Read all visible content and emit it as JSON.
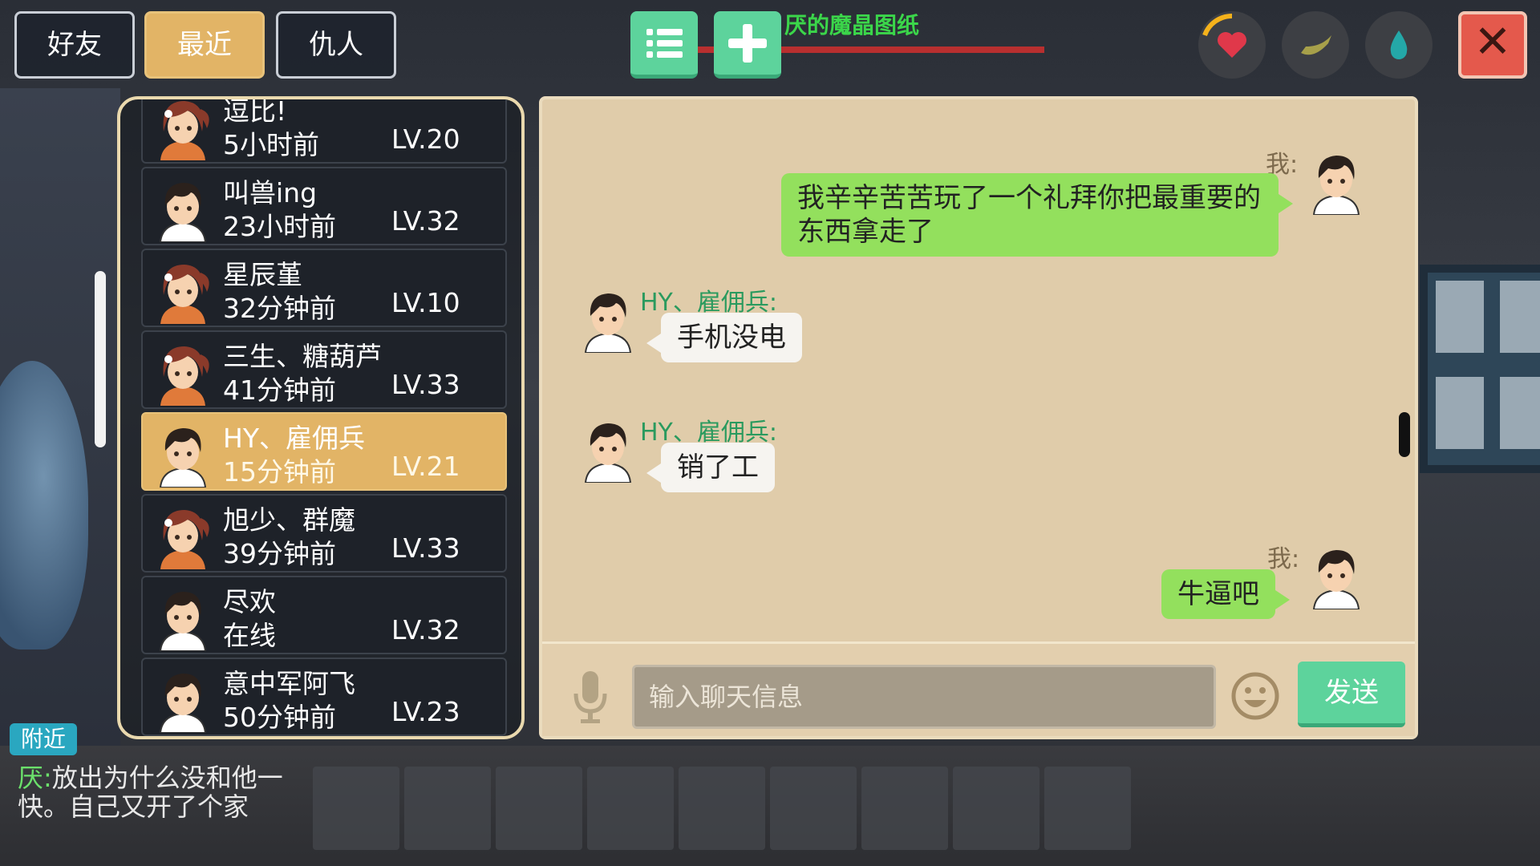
{
  "tabs": [
    {
      "label": "好友",
      "active": false
    },
    {
      "label": "最近",
      "active": true
    },
    {
      "label": "仇人",
      "active": false
    }
  ],
  "top_bar": {
    "quest_text": "厌的魔晶图纸",
    "list_icon": "list-icon",
    "add_icon": "plus-icon",
    "status_icons": [
      "heart-icon",
      "food-icon",
      "water-drop-icon"
    ],
    "close_icon": "close-icon",
    "close_symbol": "✕"
  },
  "friends": [
    {
      "name": "逗比!",
      "time": "5小时前",
      "level": "LV.20",
      "avatar": "female-avatar"
    },
    {
      "name": "叫兽ing",
      "time": "23小时前",
      "level": "LV.32",
      "avatar": "male-avatar"
    },
    {
      "name": "星辰堇",
      "time": "32分钟前",
      "level": "LV.10",
      "avatar": "female-avatar"
    },
    {
      "name": "三生、糖葫芦",
      "time": "41分钟前",
      "level": "LV.33",
      "avatar": "female-avatar"
    },
    {
      "name": "HY、雇佣兵",
      "time": "15分钟前",
      "level": "LV.21",
      "avatar": "male-avatar",
      "selected": true
    },
    {
      "name": "旭少、群魔",
      "time": "39分钟前",
      "level": "LV.33",
      "avatar": "female-avatar"
    },
    {
      "name": "尽欢",
      "time": "在线",
      "level": "LV.32",
      "avatar": "male-avatar"
    },
    {
      "name": "意中军阿飞",
      "time": "50分钟前",
      "level": "LV.23",
      "avatar": "male-avatar"
    }
  ],
  "messages": [
    {
      "sender": "我:",
      "from_me": true,
      "text_line1": "我辛辛苦苦玩了一个礼拜你把最重要的",
      "text_line2": "东西拿走了"
    },
    {
      "sender": "HY、雇佣兵:",
      "from_me": false,
      "text": "手机没电"
    },
    {
      "sender": "HY、雇佣兵:",
      "from_me": false,
      "text": "销了工"
    },
    {
      "sender": "我:",
      "from_me": true,
      "text": "牛逼吧"
    }
  ],
  "input": {
    "placeholder": "输入聊天信息",
    "send_label": "发送",
    "mic_icon": "microphone-icon",
    "emoji_icon": "smiley-icon"
  },
  "bottom": {
    "nearby_label": "附近",
    "chat_who": "厌:",
    "chat_text": "放出为什么没和他一快。自己又开了个家"
  },
  "colors": {
    "accent_gold": "#e2b466",
    "accent_green": "#5dd39c",
    "bubble_me": "#93e05d",
    "close_red": "#e4594c"
  }
}
